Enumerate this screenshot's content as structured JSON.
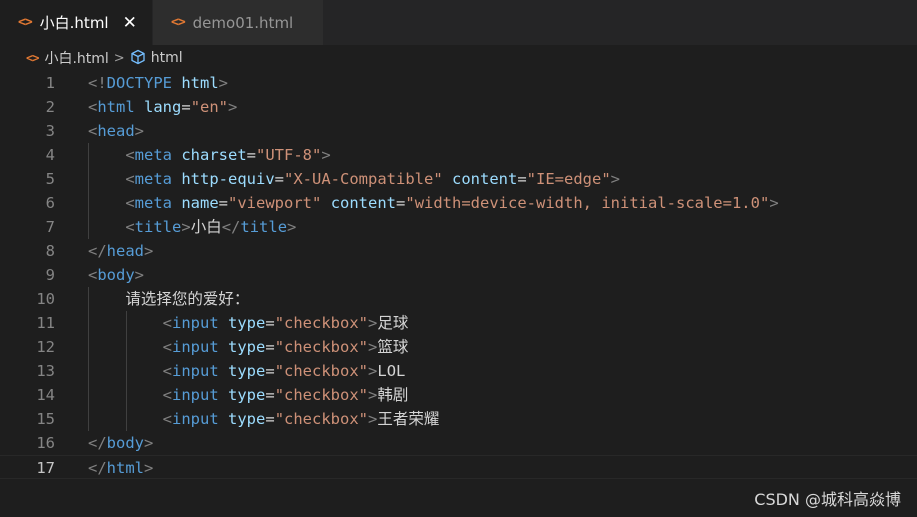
{
  "tabs": [
    {
      "label": "小白.html",
      "active": true,
      "icon": "html-code-icon",
      "close": "✕"
    },
    {
      "label": "demo01.html",
      "active": false,
      "icon": "html-code-icon"
    }
  ],
  "breadcrumb": {
    "file": "小白.html",
    "separator": ">",
    "symbol": "html"
  },
  "editor": {
    "current_line": 17,
    "lines": [
      {
        "n": "1",
        "tokens": [
          [
            "p",
            "<!"
          ],
          [
            "tag",
            "DOCTYPE"
          ],
          [
            "t",
            " "
          ],
          [
            "attr",
            "html"
          ],
          [
            "p",
            ">"
          ]
        ]
      },
      {
        "n": "2",
        "tokens": [
          [
            "p",
            "<"
          ],
          [
            "tag",
            "html"
          ],
          [
            "t",
            " "
          ],
          [
            "attr",
            "lang"
          ],
          [
            "t",
            "="
          ],
          [
            "str",
            "\"en\""
          ],
          [
            "p",
            ">"
          ]
        ]
      },
      {
        "n": "3",
        "tokens": [
          [
            "p",
            "<"
          ],
          [
            "tag",
            "head"
          ],
          [
            "p",
            ">"
          ]
        ]
      },
      {
        "n": "4",
        "tokens": [
          [
            "t",
            "    "
          ],
          [
            "p",
            "<"
          ],
          [
            "tag",
            "meta"
          ],
          [
            "t",
            " "
          ],
          [
            "attr",
            "charset"
          ],
          [
            "t",
            "="
          ],
          [
            "str",
            "\"UTF-8\""
          ],
          [
            "p",
            ">"
          ]
        ]
      },
      {
        "n": "5",
        "tokens": [
          [
            "t",
            "    "
          ],
          [
            "p",
            "<"
          ],
          [
            "tag",
            "meta"
          ],
          [
            "t",
            " "
          ],
          [
            "attr",
            "http-equiv"
          ],
          [
            "t",
            "="
          ],
          [
            "str",
            "\"X-UA-Compatible\""
          ],
          [
            "t",
            " "
          ],
          [
            "attr",
            "content"
          ],
          [
            "t",
            "="
          ],
          [
            "str",
            "\"IE=edge\""
          ],
          [
            "p",
            ">"
          ]
        ]
      },
      {
        "n": "6",
        "tokens": [
          [
            "t",
            "    "
          ],
          [
            "p",
            "<"
          ],
          [
            "tag",
            "meta"
          ],
          [
            "t",
            " "
          ],
          [
            "attr",
            "name"
          ],
          [
            "t",
            "="
          ],
          [
            "str",
            "\"viewport\""
          ],
          [
            "t",
            " "
          ],
          [
            "attr",
            "content"
          ],
          [
            "t",
            "="
          ],
          [
            "str",
            "\"width=device-width, initial-scale=1.0\""
          ],
          [
            "p",
            ">"
          ]
        ]
      },
      {
        "n": "7",
        "tokens": [
          [
            "t",
            "    "
          ],
          [
            "p",
            "<"
          ],
          [
            "tag",
            "title"
          ],
          [
            "p",
            ">"
          ],
          [
            "t",
            "小白"
          ],
          [
            "p",
            "</"
          ],
          [
            "tag",
            "title"
          ],
          [
            "p",
            ">"
          ]
        ]
      },
      {
        "n": "8",
        "tokens": [
          [
            "p",
            "</"
          ],
          [
            "tag",
            "head"
          ],
          [
            "p",
            ">"
          ]
        ]
      },
      {
        "n": "9",
        "tokens": [
          [
            "p",
            "<"
          ],
          [
            "tag",
            "body"
          ],
          [
            "p",
            ">"
          ]
        ]
      },
      {
        "n": "10",
        "tokens": [
          [
            "t",
            "    请选择您的爱好："
          ]
        ]
      },
      {
        "n": "11",
        "tokens": [
          [
            "t",
            "        "
          ],
          [
            "p",
            "<"
          ],
          [
            "tag",
            "input"
          ],
          [
            "t",
            " "
          ],
          [
            "attr",
            "type"
          ],
          [
            "t",
            "="
          ],
          [
            "str",
            "\"checkbox\""
          ],
          [
            "p",
            ">"
          ],
          [
            "t",
            "足球"
          ]
        ]
      },
      {
        "n": "12",
        "tokens": [
          [
            "t",
            "        "
          ],
          [
            "p",
            "<"
          ],
          [
            "tag",
            "input"
          ],
          [
            "t",
            " "
          ],
          [
            "attr",
            "type"
          ],
          [
            "t",
            "="
          ],
          [
            "str",
            "\"checkbox\""
          ],
          [
            "p",
            ">"
          ],
          [
            "t",
            "篮球"
          ]
        ]
      },
      {
        "n": "13",
        "tokens": [
          [
            "t",
            "        "
          ],
          [
            "p",
            "<"
          ],
          [
            "tag",
            "input"
          ],
          [
            "t",
            " "
          ],
          [
            "attr",
            "type"
          ],
          [
            "t",
            "="
          ],
          [
            "str",
            "\"checkbox\""
          ],
          [
            "p",
            ">"
          ],
          [
            "t",
            "LOL"
          ]
        ]
      },
      {
        "n": "14",
        "tokens": [
          [
            "t",
            "        "
          ],
          [
            "p",
            "<"
          ],
          [
            "tag",
            "input"
          ],
          [
            "t",
            " "
          ],
          [
            "attr",
            "type"
          ],
          [
            "t",
            "="
          ],
          [
            "str",
            "\"checkbox\""
          ],
          [
            "p",
            ">"
          ],
          [
            "t",
            "韩剧"
          ]
        ]
      },
      {
        "n": "15",
        "tokens": [
          [
            "t",
            "        "
          ],
          [
            "p",
            "<"
          ],
          [
            "tag",
            "input"
          ],
          [
            "t",
            " "
          ],
          [
            "attr",
            "type"
          ],
          [
            "t",
            "="
          ],
          [
            "str",
            "\"checkbox\""
          ],
          [
            "p",
            ">"
          ],
          [
            "t",
            "王者荣耀"
          ]
        ]
      },
      {
        "n": "16",
        "tokens": [
          [
            "p",
            "</"
          ],
          [
            "tag",
            "body"
          ],
          [
            "p",
            ">"
          ]
        ]
      },
      {
        "n": "17",
        "tokens": [
          [
            "p",
            "</"
          ],
          [
            "tag",
            "html"
          ],
          [
            "p",
            ">"
          ]
        ]
      }
    ]
  },
  "watermark": "CSDN @城科高焱博",
  "colors": {
    "background": "#1e1e1e",
    "tag": "#569cd6",
    "attribute": "#9cdcfe",
    "string": "#ce9178",
    "punctuation": "#808080",
    "text": "#d4d4d4",
    "html_icon": "#e37933",
    "symbol_icon": "#75beff"
  }
}
